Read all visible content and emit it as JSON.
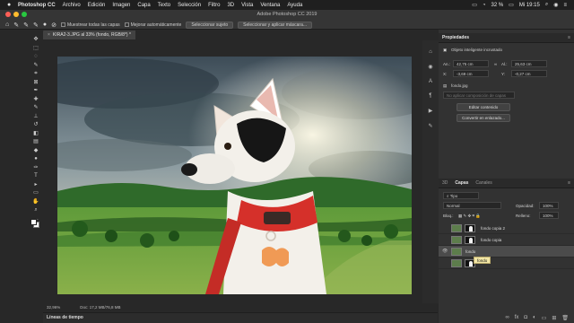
{
  "menubar": {
    "apple": "",
    "items": [
      "Photoshop CC",
      "Archivo",
      "Edición",
      "Imagen",
      "Capa",
      "Texto",
      "Selección",
      "Filtro",
      "3D",
      "Vista",
      "Ventana",
      "Ayuda"
    ],
    "battery": "32 %",
    "clock": "Mi 19:15"
  },
  "window": {
    "title": "Adobe Photoshop CC 2019"
  },
  "options": {
    "sample_all_layers": "Muestrear todas las capas",
    "auto_enhance": "Mejorar automáticamente",
    "select_subject": "Seleccionar sujeto",
    "select_and_mask": "Seleccionar y aplicar máscara..."
  },
  "document": {
    "tab_label": "KIRA2-3.JPG al 33% (fondo, RGB/8*) *",
    "close": "×"
  },
  "status": {
    "zoom": "32,96%",
    "doc_size": "Doc: 17,2 MB/76,8 MB"
  },
  "timeline": {
    "label": "Líneas de tiempo"
  },
  "properties": {
    "title": "Propiedades",
    "object_type": "Objeto inteligente incrustado",
    "width_label": "An.:",
    "width_value": "42,75 cm",
    "height_label": "Al.:",
    "height_value": "25,63 cm",
    "x_label": "X:",
    "x_value": "-3,69 cm",
    "y_label": "Y:",
    "y_value": "-0,27 cm",
    "file_name": "fondo.jpg",
    "comp_placeholder": "No aplicar composición de capas",
    "edit_contents": "Editar contenido",
    "convert_to_linked": "Convertir en enlazado..."
  },
  "layers": {
    "tabs": [
      "3D",
      "Capas",
      "Canales"
    ],
    "kind": "Tipo",
    "blend_mode": "Normal",
    "opacity_label": "Opacidad:",
    "opacity": "100%",
    "lock_label": "Bloq.:",
    "fill_label": "Relleno:",
    "fill": "100%",
    "items": [
      {
        "name": "fondo copia 2",
        "selected": false
      },
      {
        "name": "fondo copia",
        "selected": false
      },
      {
        "name": "fondo",
        "selected": true
      },
      {
        "name": "",
        "selected": false
      }
    ],
    "tooltip": "fondo"
  },
  "colors": {
    "accent": "#1473e6",
    "panel_bg": "#323232",
    "app_bg": "#282828"
  }
}
